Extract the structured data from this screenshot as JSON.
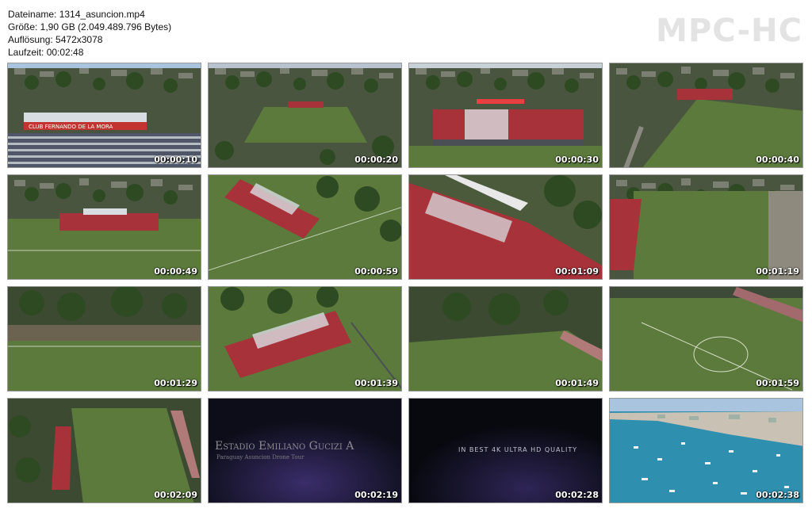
{
  "info": {
    "filename": "Dateiname: 1314_asuncion.mp4",
    "size": "Größe: 1,90 GB (2.049.489.796 Bytes)",
    "resolution": "Auflösung: 5472x3078",
    "duration": "Laufzeit: 00:02:48"
  },
  "logo": "MPC-HC",
  "thumbnails": [
    {
      "time": "00:00:10",
      "scene": "stadium-grandstand-sign"
    },
    {
      "time": "00:00:20",
      "scene": "aerial-field-city"
    },
    {
      "time": "00:00:30",
      "scene": "grandstand-frontal"
    },
    {
      "time": "00:00:40",
      "scene": "aerial-field-angle"
    },
    {
      "time": "00:00:49",
      "scene": "field-grandstand-far"
    },
    {
      "time": "00:00:59",
      "scene": "grandstand-diagonal"
    },
    {
      "time": "00:01:09",
      "scene": "grandstand-closeup"
    },
    {
      "time": "00:01:19",
      "scene": "field-side-grandstand"
    },
    {
      "time": "00:01:29",
      "scene": "field-trees-side"
    },
    {
      "time": "00:01:39",
      "scene": "grandstand-top-down"
    },
    {
      "time": "00:01:49",
      "scene": "field-trees-angle"
    },
    {
      "time": "00:01:59",
      "scene": "field-center-circle"
    },
    {
      "time": "00:02:09",
      "scene": "field-top-down"
    },
    {
      "time": "00:02:19",
      "scene": "title-card",
      "title_line1": "Estadio Emiliano Gucizi A",
      "title_line2": "Paraguay Asuncion Drone Tour"
    },
    {
      "time": "00:02:28",
      "scene": "title-card-quality",
      "caption": "IN BEST 4K ULTRA HD QUALITY"
    },
    {
      "time": "00:02:38",
      "scene": "harbor-boats"
    }
  ],
  "stadium_sign": "CLUB FERNANDO DE LA MORA",
  "colors": {
    "grass": "#5b7a3c",
    "seats_red": "#a8323a",
    "seats_white": "#d8dde2",
    "roof": "#e8e8e8",
    "trees": "#2e4a22",
    "dark_title": "#0c0d18",
    "water": "#2f8fae",
    "sky": "#a9c4df"
  }
}
